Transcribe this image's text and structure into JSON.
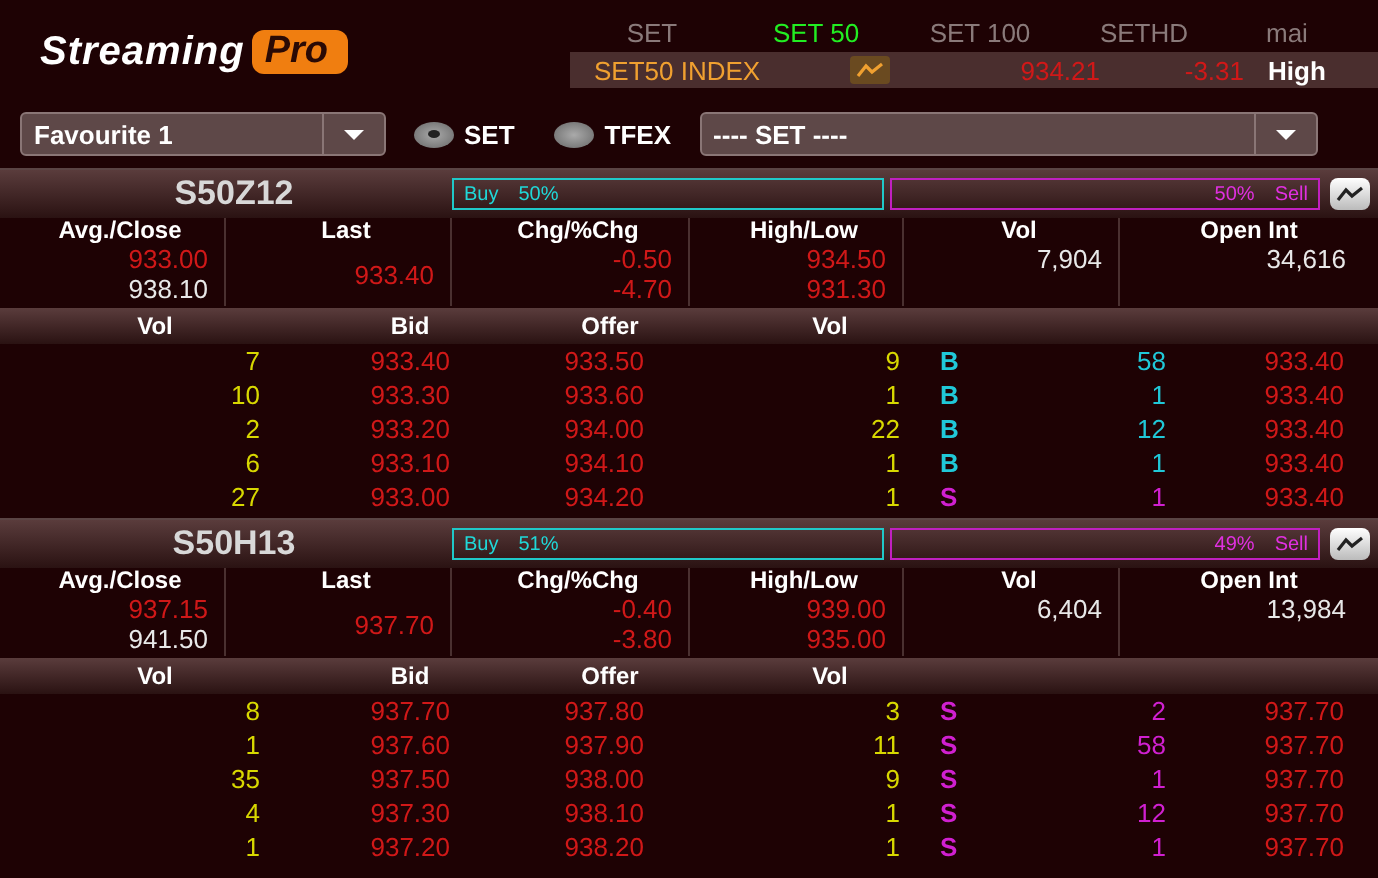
{
  "logo": {
    "word": "Streaming",
    "badge": "Pro"
  },
  "market_tabs": [
    {
      "label": "SET",
      "selected": false
    },
    {
      "label": "SET 50",
      "selected": true
    },
    {
      "label": "SET 100",
      "selected": false
    },
    {
      "label": "SETHD",
      "selected": false
    },
    {
      "label": "mai",
      "selected": false
    }
  ],
  "index": {
    "name": "SET50 INDEX",
    "value": "934.21",
    "change": "-3.31",
    "status": "High"
  },
  "favourite": {
    "value": "Favourite 1"
  },
  "markets": [
    {
      "label": "SET",
      "selected": true
    },
    {
      "label": "TFEX",
      "selected": false
    }
  ],
  "symbol_select": {
    "value": "---- SET ----"
  },
  "series": [
    {
      "symbol": "S50Z12",
      "buy_label": "Buy",
      "buy_pct": "50%",
      "sell_label": "Sell",
      "sell_pct": "50%",
      "stat_columns": [
        "Avg./Close",
        "Last",
        "Chg/%Chg",
        "High/Low",
        "Vol",
        "Open Int"
      ],
      "book_columns": [
        "Vol",
        "Bid",
        "Offer",
        "Vol"
      ],
      "avg": "933.00",
      "close": "938.10",
      "last": "933.40",
      "chg": "-0.50",
      "pct_chg": "-4.70",
      "high": "934.50",
      "low": "931.30",
      "vol": "7,904",
      "open_int": "34,616",
      "book": [
        {
          "bid_vol": "7",
          "bid": "933.40",
          "offer": "933.50",
          "offer_vol": "9",
          "side": "B",
          "kind": "buy",
          "trade_vol": "58",
          "trade_price": "933.40"
        },
        {
          "bid_vol": "10",
          "bid": "933.30",
          "offer": "933.60",
          "offer_vol": "1",
          "side": "B",
          "kind": "buy",
          "trade_vol": "1",
          "trade_price": "933.40"
        },
        {
          "bid_vol": "2",
          "bid": "933.20",
          "offer": "934.00",
          "offer_vol": "22",
          "side": "B",
          "kind": "buy",
          "trade_vol": "12",
          "trade_price": "933.40"
        },
        {
          "bid_vol": "6",
          "bid": "933.10",
          "offer": "934.10",
          "offer_vol": "1",
          "side": "B",
          "kind": "buy",
          "trade_vol": "1",
          "trade_price": "933.40"
        },
        {
          "bid_vol": "27",
          "bid": "933.00",
          "offer": "934.20",
          "offer_vol": "1",
          "side": "S",
          "kind": "sell",
          "trade_vol": "1",
          "trade_price": "933.40"
        }
      ]
    },
    {
      "symbol": "S50H13",
      "buy_label": "Buy",
      "buy_pct": "51%",
      "sell_label": "Sell",
      "sell_pct": "49%",
      "stat_columns": [
        "Avg./Close",
        "Last",
        "Chg/%Chg",
        "High/Low",
        "Vol",
        "Open Int"
      ],
      "book_columns": [
        "Vol",
        "Bid",
        "Offer",
        "Vol"
      ],
      "avg": "937.15",
      "close": "941.50",
      "last": "937.70",
      "chg": "-0.40",
      "pct_chg": "-3.80",
      "high": "939.00",
      "low": "935.00",
      "vol": "6,404",
      "open_int": "13,984",
      "book": [
        {
          "bid_vol": "8",
          "bid": "937.70",
          "offer": "937.80",
          "offer_vol": "3",
          "side": "S",
          "kind": "sell",
          "trade_vol": "2",
          "trade_price": "937.70"
        },
        {
          "bid_vol": "1",
          "bid": "937.60",
          "offer": "937.90",
          "offer_vol": "11",
          "side": "S",
          "kind": "sell",
          "trade_vol": "58",
          "trade_price": "937.70"
        },
        {
          "bid_vol": "35",
          "bid": "937.50",
          "offer": "938.00",
          "offer_vol": "9",
          "side": "S",
          "kind": "sell",
          "trade_vol": "1",
          "trade_price": "937.70"
        },
        {
          "bid_vol": "4",
          "bid": "937.30",
          "offer": "938.10",
          "offer_vol": "1",
          "side": "S",
          "kind": "sell",
          "trade_vol": "12",
          "trade_price": "937.70"
        },
        {
          "bid_vol": "1",
          "bid": "937.20",
          "offer": "938.20",
          "offer_vol": "1",
          "side": "S",
          "kind": "sell",
          "trade_vol": "1",
          "trade_price": "937.70"
        }
      ]
    }
  ]
}
